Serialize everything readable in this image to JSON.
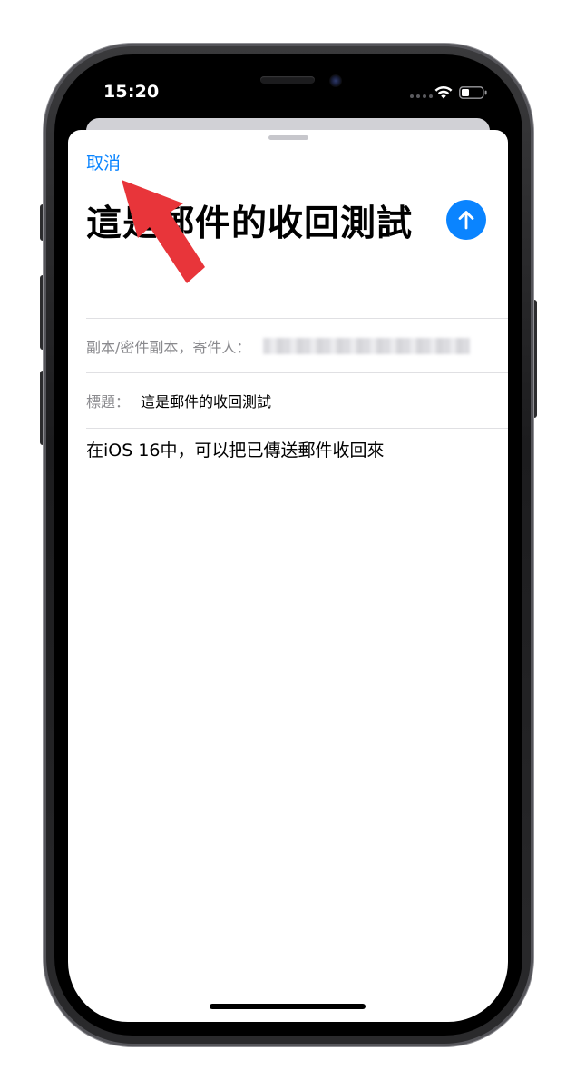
{
  "status_bar": {
    "time": "15:20"
  },
  "compose": {
    "cancel_label": "取消",
    "title": "這是郵件的收回測試",
    "send_icon": "arrow-up-icon",
    "cc_label": "副本/密件副本，寄件人：",
    "subject_label": "標題：",
    "subject_value": "這是郵件的收回測試",
    "body": "在iOS 16中，可以把已傳送郵件收回來"
  },
  "colors": {
    "accent": "#0a84ff",
    "annotation_arrow": "#e8353a",
    "label_gray": "#8a8a8e"
  }
}
